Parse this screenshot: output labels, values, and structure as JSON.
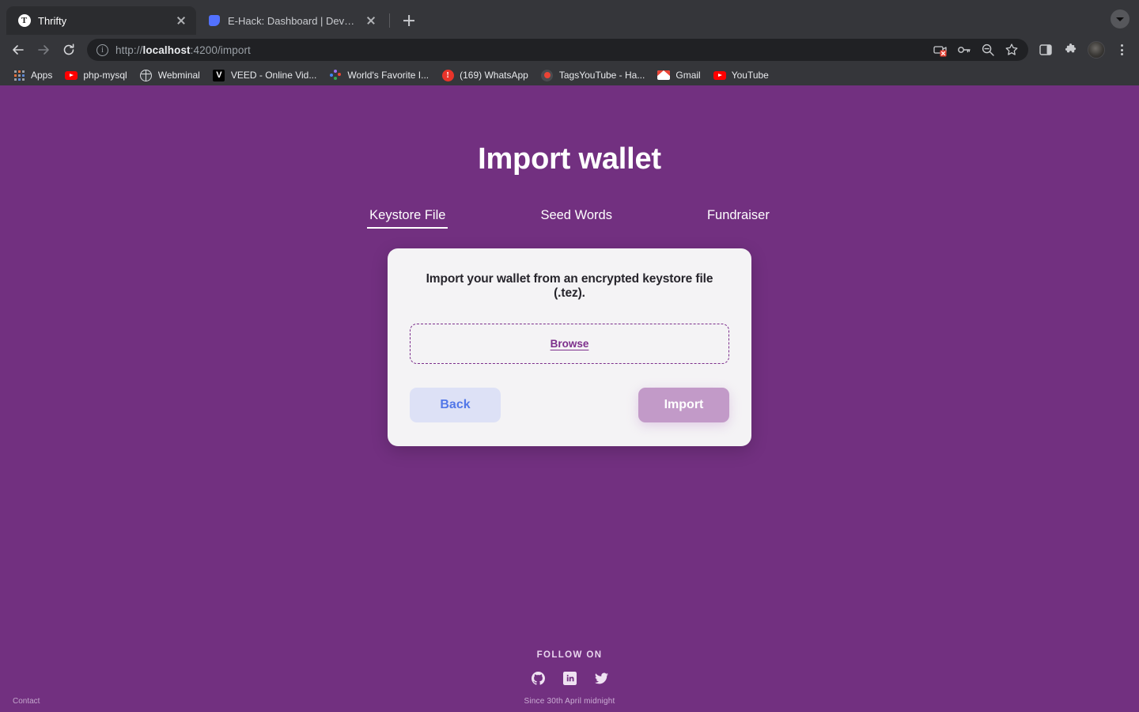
{
  "browser": {
    "tabs": [
      {
        "title": "Thrifty",
        "favicon": "thrifty-t-icon",
        "active": true
      },
      {
        "title": "E-Hack: Dashboard | Devfolio",
        "favicon": "devfolio-icon",
        "active": false
      }
    ],
    "new_tab_label": "+",
    "tab_search_icon": "chevron-down-icon",
    "nav": {
      "back_icon": "arrow-left-icon",
      "forward_icon": "arrow-right-icon",
      "reload_icon": "reload-icon"
    },
    "omnibox": {
      "site_info_icon": "info-circle-icon",
      "url_scheme": "http://",
      "url_host": "localhost",
      "url_rest": ":4200/import",
      "full_url": "http://localhost:4200/import",
      "actions": [
        "camera-blocked-icon",
        "key-icon",
        "zoom-out-icon",
        "star-bookmark-icon"
      ]
    },
    "toolbar_right": [
      "side-panel-icon",
      "extensions-puzzle-icon",
      "profile-avatar",
      "kebab-menu-icon"
    ],
    "bookmarks": [
      {
        "label": "Apps",
        "icon": "apps-grid-icon"
      },
      {
        "label": "php-mysql",
        "icon": "youtube-icon"
      },
      {
        "label": "Webminal",
        "icon": "globe-icon"
      },
      {
        "label": "VEED - Online Vid...",
        "icon": "veed-icon"
      },
      {
        "label": "World's Favorite I...",
        "icon": "confetti-icon"
      },
      {
        "label": "(169) WhatsApp",
        "icon": "alert-icon"
      },
      {
        "label": "TagsYouTube - Ha...",
        "icon": "record-icon"
      },
      {
        "label": "Gmail",
        "icon": "gmail-icon"
      },
      {
        "label": "YouTube",
        "icon": "youtube-icon"
      }
    ]
  },
  "page": {
    "title": "Import wallet",
    "tabs": [
      {
        "label": "Keystore File",
        "active": true
      },
      {
        "label": "Seed Words",
        "active": false
      },
      {
        "label": "Fundraiser",
        "active": false
      }
    ],
    "card": {
      "heading": "Import your wallet from an encrypted keystore file (.tez).",
      "browse_label": "Browse",
      "back_label": "Back",
      "import_label": "Import"
    },
    "footer": {
      "follow_on": "FOLLOW ON",
      "socials": [
        "github-icon",
        "linkedin-icon",
        "twitter-icon"
      ],
      "since": "Since 30th April midnight",
      "contact": "Contact"
    },
    "colors": {
      "background": "#723080",
      "card_background": "#f4f3f5",
      "accent_purple": "#7d2f8c",
      "back_button_bg": "#dde1f6",
      "back_button_text": "#5277e8",
      "import_button_bg": "#c29ac8"
    }
  }
}
